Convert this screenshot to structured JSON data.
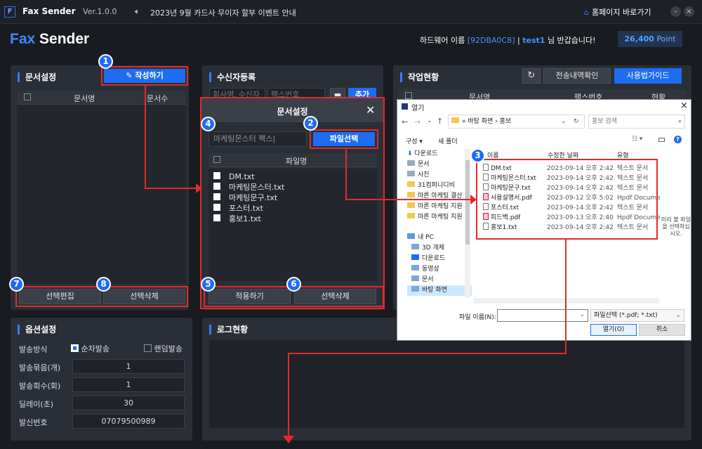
{
  "titlebar": {
    "app_icon": "F",
    "app_name": "Fax Sender",
    "version": "Ver.1.0.0",
    "speaker_icon": "speaker-icon",
    "notice": "2023년 9월 카드사 무이자 할부 이벤트 안내",
    "home_link": "홈페이지 바로가기",
    "minimize": "–",
    "close": "×"
  },
  "header": {
    "brand_fax": "Fax",
    "brand_sender": "Sender",
    "hw_label": "하드웨어 이름",
    "hw_id": "[92DBA0C8]",
    "separator": "|",
    "user": "test1",
    "greeting": "님 반갑습니다!",
    "point_value": "26,400",
    "point_label": "Point"
  },
  "doc_panel": {
    "title": "문서설정",
    "write_button": "작성하기",
    "col_name": "문서명",
    "col_count": "문서수",
    "edit_button": "선택편집",
    "delete_button": "선택삭제"
  },
  "recipient_panel": {
    "title": "수신자등록",
    "company_placeholder": "회사명, 수신자",
    "fax_placeholder": "팩스번호",
    "add_button": "추가"
  },
  "work_panel": {
    "title": "작업현황",
    "history_button": "전송내역확인",
    "guide_button": "사용법가이드",
    "col_docname": "문서명",
    "col_fax": "팩스번호",
    "col_status": "현황"
  },
  "doc_dialog": {
    "title": "문서설정",
    "close": "✕",
    "name_value": "마케팅몬스터 팩스|",
    "select_file_button": "파일선택",
    "col_filename": "파일명",
    "files": [
      "DM.txt",
      "마케팅몬스터.txt",
      "마케팅문구.txt",
      "포스터.txt",
      "홍보1.txt"
    ],
    "apply_button": "적용하기",
    "delete_button": "선택삭제"
  },
  "options_panel": {
    "title": "옵션설정",
    "send_mode_label": "발송방식",
    "sequential": "순차발송",
    "random": "랜덤발송",
    "batch_label": "발송묶음(개)",
    "batch_value": "1",
    "repeat_label": "발송회수(회)",
    "repeat_value": "1",
    "delay_label": "딜레이(초)",
    "delay_value": "30",
    "sender_label": "발신번호",
    "sender_value": "07079500989"
  },
  "log_panel": {
    "title": "로그현황"
  },
  "badges": [
    "1",
    "2",
    "3",
    "4",
    "5",
    "6",
    "7",
    "8"
  ],
  "explorer": {
    "title": "열기",
    "close": "×",
    "path": "« 바탕 화면 › 홍보",
    "search_placeholder": "홍보 검색",
    "organize": "구성 ▾",
    "new_folder": "새 폴더",
    "nav": [
      "다운로드",
      "문서",
      "사진",
      "31컴퍼니디비",
      "마른 마케팅 결산",
      "마른 마케팅 지원",
      "마른 마케팅 지원"
    ],
    "nav2_title": "내 PC",
    "nav2": [
      "3D 개체",
      "다운로드",
      "동영상",
      "문서",
      "바탕 화면"
    ],
    "col_name": "이름",
    "col_date": "수정한 날짜",
    "col_type": "유형",
    "files": [
      {
        "name": "DM.txt",
        "date": "2023-09-14 오후 2:42",
        "type": "텍스트 문서",
        "icon": "txt"
      },
      {
        "name": "마케팅몬스터.txt",
        "date": "2023-09-14 오후 2:42",
        "type": "텍스트 문서",
        "icon": "txt"
      },
      {
        "name": "마케팅문구.txt",
        "date": "2023-09-14 오후 2:42",
        "type": "텍스트 문서",
        "icon": "txt"
      },
      {
        "name": "사용설명서.pdf",
        "date": "2023-09-12 오후 5:02",
        "type": "Hpdf Docume",
        "icon": "pdf"
      },
      {
        "name": "포스터.txt",
        "date": "2023-09-14 오후 2:42",
        "type": "텍스트 문서",
        "icon": "txt"
      },
      {
        "name": "피드백.pdf",
        "date": "2023-09-13 오후 2:40",
        "type": "Hpdf Docume",
        "icon": "pdf"
      },
      {
        "name": "홍보1.txt",
        "date": "2023-09-14 오후 2:42",
        "type": "텍스트 문서",
        "icon": "txt"
      }
    ],
    "preview_text": "미리 볼 파일을 선택하십시오.",
    "filename_label": "파일 이름(N):",
    "filter": "파일선택 (*.pdf; *.txt)",
    "open_button": "열기(O)",
    "cancel_button": "취소"
  },
  "colors": {
    "accent": "#1e6cf0",
    "highlight": "#e02b2b",
    "panel": "#2a2e36",
    "background": "#181b20"
  }
}
